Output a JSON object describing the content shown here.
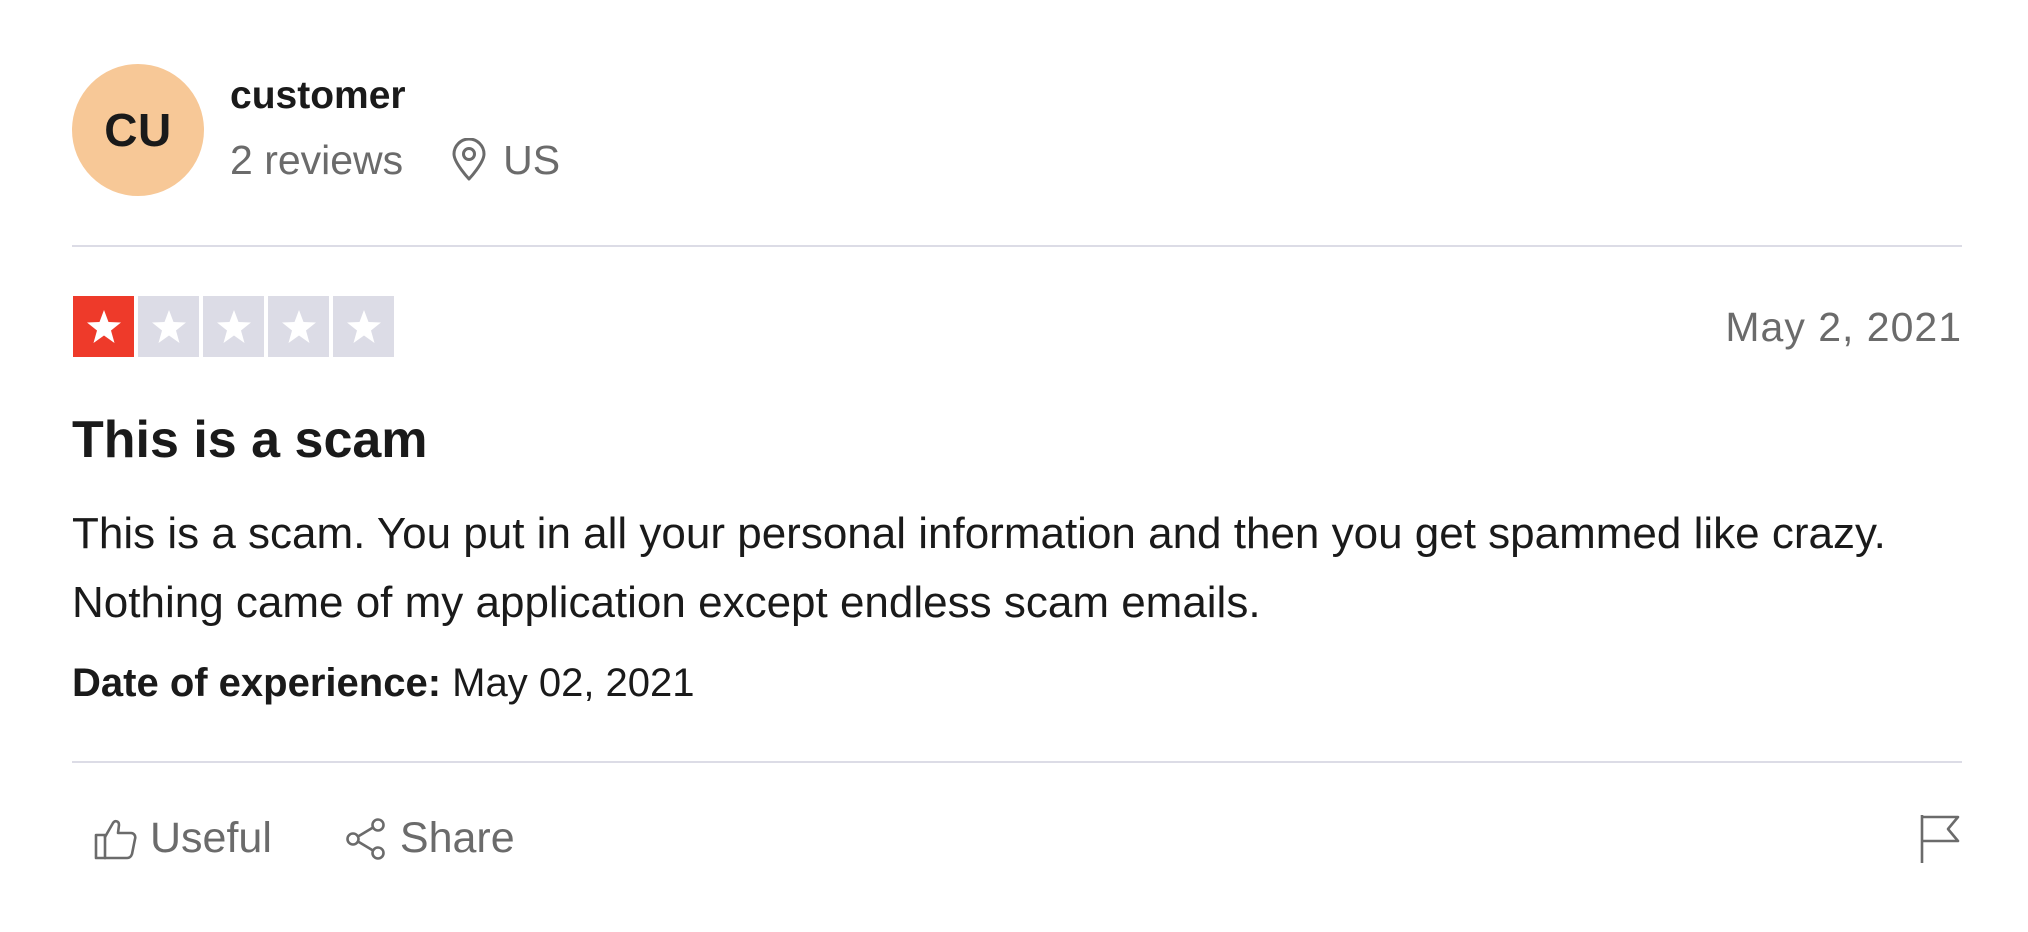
{
  "reviewer": {
    "initials": "CU",
    "name": "customer",
    "review_count": "2 reviews",
    "location": "US",
    "avatar_color": "#f7c897"
  },
  "review": {
    "rating": 1,
    "rating_max": 5,
    "star_filled_color": "#ee3a2a",
    "star_empty_color": "#dcdce6",
    "date": "May 2, 2021",
    "title": "This is a scam",
    "body": "This is a scam. You put in all your personal information and then you get spammed like crazy. Nothing came of my application except endless scam emails.",
    "experience_label": "Date of experience:",
    "experience_date": "May 02, 2021"
  },
  "actions": {
    "useful_label": "Useful",
    "share_label": "Share",
    "icons": [
      "thumbs-up-icon",
      "share-icon",
      "flag-icon"
    ]
  }
}
